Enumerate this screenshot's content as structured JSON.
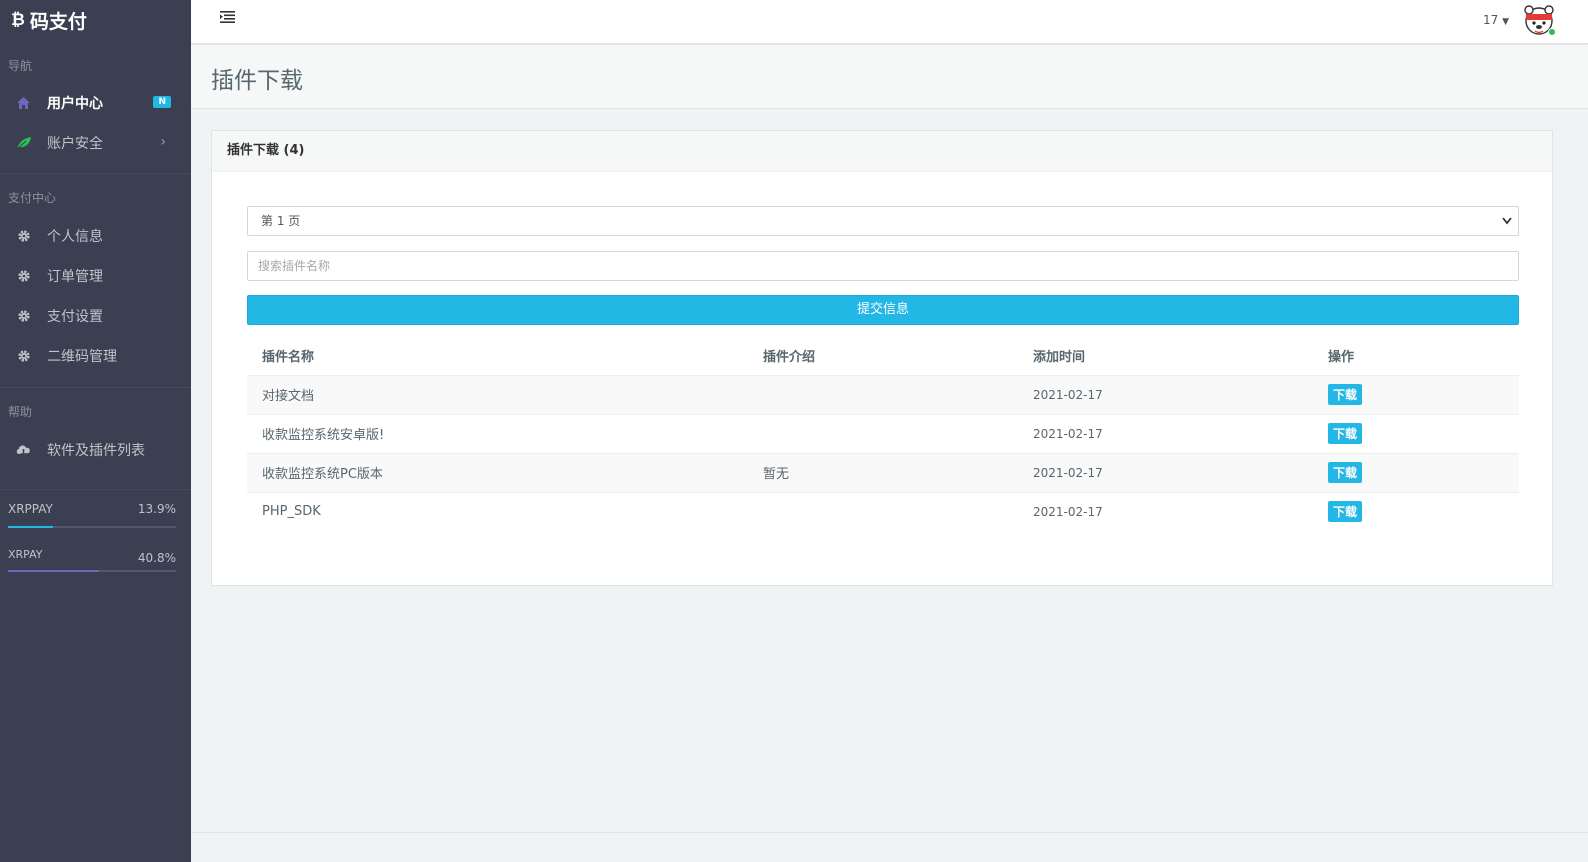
{
  "brand": {
    "logo": "₿",
    "name": "码支付"
  },
  "sidebar": {
    "sections": [
      {
        "heading": "导航"
      },
      {
        "heading": "支付中心"
      },
      {
        "heading": "帮助"
      }
    ],
    "nav": [
      {
        "label": "用户中心",
        "icon": "home-icon",
        "badge": "N",
        "active": true
      },
      {
        "label": "账户安全",
        "icon": "leaf-icon",
        "has_submenu": true
      },
      {
        "label": "个人信息",
        "icon": "gear-icon"
      },
      {
        "label": "订单管理",
        "icon": "gear-icon"
      },
      {
        "label": "支付设置",
        "icon": "gear-icon"
      },
      {
        "label": "二维码管理",
        "icon": "gear-icon"
      },
      {
        "label": "软件及插件列表",
        "icon": "cloud-download-icon"
      }
    ],
    "stats": [
      {
        "label": "XRPPAY",
        "value": "13.9%",
        "progress": 0.27,
        "color": "#23b7e5"
      },
      {
        "label": "XRPAY",
        "value": "40.8%",
        "progress": 0.54,
        "color": "#7266ba"
      }
    ]
  },
  "topbar": {
    "user_num": "17"
  },
  "page": {
    "title": "插件下载"
  },
  "panel": {
    "heading": "插件下载 (4)",
    "page_select": "第 1 页",
    "search_placeholder": "搜索插件名称",
    "submit_label": "提交信息",
    "table": {
      "headers": [
        "插件名称",
        "插件介绍",
        "添加时间",
        "操作"
      ],
      "rows": [
        {
          "name": "对接文档",
          "desc": "",
          "date": "2021-02-17",
          "action": "下载"
        },
        {
          "name": "收款监控系统安卓版!",
          "desc": "",
          "date": "2021-02-17",
          "action": "下载"
        },
        {
          "name": "收款监控系统PC版本",
          "desc": "暂无",
          "date": "2021-02-17",
          "action": "下载"
        },
        {
          "name": "PHP_SDK",
          "desc": "",
          "date": "2021-02-17",
          "action": "下载"
        }
      ]
    }
  }
}
